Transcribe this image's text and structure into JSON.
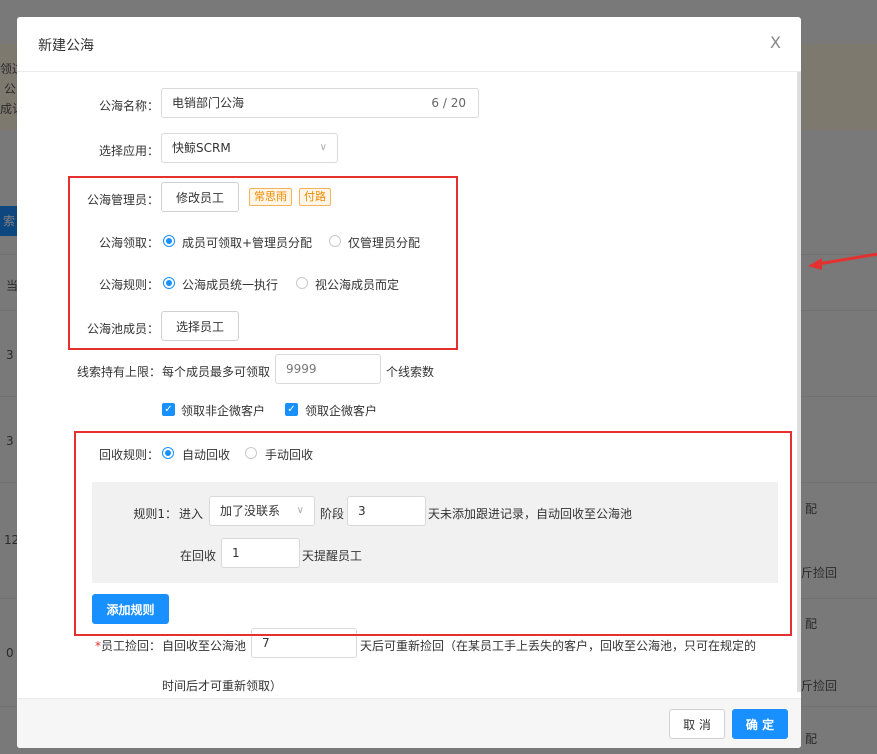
{
  "modal": {
    "title": "新建公海",
    "close_label": "X"
  },
  "form": {
    "name": {
      "label": "公海名称：",
      "value": "电销部门公海",
      "counter": "6 / 20"
    },
    "app": {
      "label": "选择应用：",
      "value": "快鲸SCRM"
    },
    "admin": {
      "label": "公海管理员：",
      "button": "修改员工",
      "tags": [
        "常思雨",
        "付路"
      ]
    },
    "claim": {
      "label": "公海领取：",
      "options": [
        "成员可领取+管理员分配",
        "仅管理员分配"
      ],
      "selected": 0
    },
    "rule": {
      "label": "公海规则：",
      "options": [
        "公海成员统一执行",
        "视公海成员而定"
      ],
      "selected": 0
    },
    "members": {
      "label": "公海池成员：",
      "button": "选择员工"
    },
    "limit": {
      "label": "线索持有上限：",
      "prefix": "每个成员最多可领取",
      "value": "9999",
      "suffix": "个线索数"
    },
    "checks": [
      "领取非企微客户",
      "领取企微客户"
    ],
    "recycle": {
      "label": "回收规则：",
      "options": [
        "自动回收",
        "手动回收"
      ],
      "selected": 0
    },
    "rule1": {
      "label": "规则1：",
      "enter": "进入",
      "stage_value": "加了没联系",
      "stage": "阶段",
      "days": "3",
      "days_suffix": "天未添加跟进记录，自动回收至公海池",
      "remind_prefix": "在回收",
      "remind_value": "1",
      "remind_suffix": "天提醒员工"
    },
    "add_rule": "添加规则",
    "pickback": {
      "required": "*",
      "label": "员工捡回：",
      "prefix": "自回收至公海池",
      "value": "7",
      "suffix": "天后可重新捡回（在某员工手上丢失的客户，回收至公海池，只可在规定的",
      "line2": "时间后才可重新领取）"
    }
  },
  "footer": {
    "cancel": "取 消",
    "confirm": "确 定"
  },
  "background": {
    "notice_lines": [
      "领过",
      "公",
      "成认("
    ],
    "search_btn": "索",
    "col_head": "当",
    "row_nums": [
      "3",
      "3",
      "12",
      "0"
    ],
    "right_texts": [
      "配",
      "斤捡回",
      "配",
      "斤捡回",
      "配"
    ]
  },
  "colors": {
    "primary": "#1890ff",
    "highlight": "#e53030",
    "tag": "#f08a00"
  }
}
